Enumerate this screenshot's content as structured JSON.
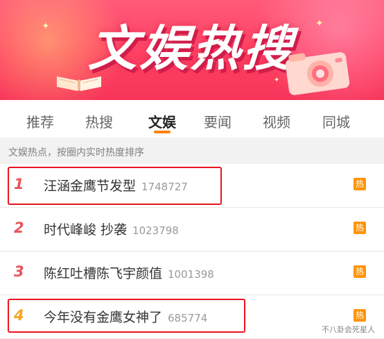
{
  "banner": {
    "title": "文娱热搜"
  },
  "tabs": [
    {
      "label": "推荐"
    },
    {
      "label": "热搜"
    },
    {
      "label": "文娱"
    },
    {
      "label": "要闻"
    },
    {
      "label": "视频"
    },
    {
      "label": "同城"
    }
  ],
  "active_tab": "文娱",
  "subheader": "文娱热点，按圈内实时热度排序",
  "list": [
    {
      "rank": "1",
      "title": "汪涵金鹰节发型",
      "count": "1748727",
      "badge": "热",
      "highlighted": true
    },
    {
      "rank": "2",
      "title": "时代峰峻 抄袭",
      "count": "1023798",
      "badge": "热",
      "highlighted": false
    },
    {
      "rank": "3",
      "title": "陈红吐槽陈飞宇颜值",
      "count": "1001398",
      "badge": "热",
      "highlighted": false
    },
    {
      "rank": "4",
      "title": "今年没有金鹰女神了",
      "count": "685774",
      "badge": "热",
      "highlighted": true
    }
  ],
  "watermark": "不八卦会死星人",
  "colors": {
    "accent": "#ff8200",
    "rank_red": "#e8545a",
    "rank_orange": "#f5a623",
    "hot_badge": "#ff9406",
    "highlight_box": "#e8141f"
  }
}
